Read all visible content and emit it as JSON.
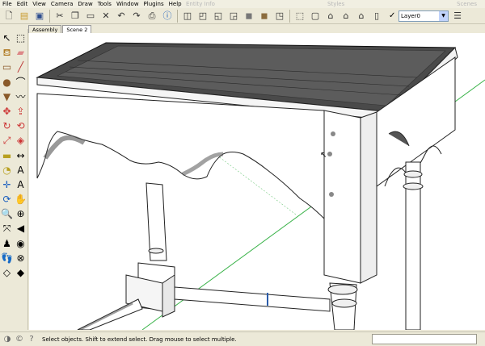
{
  "menu": [
    "File",
    "Edit",
    "View",
    "Camera",
    "Draw",
    "Tools",
    "Window",
    "Plugins",
    "Help"
  ],
  "ghost_titles": [
    "Entity Info",
    "Styles",
    "Scenes"
  ],
  "layer": {
    "label": "Layer0"
  },
  "tabs": [
    {
      "label": "Assembly",
      "active": false
    },
    {
      "label": "Scene 2",
      "active": true
    }
  ],
  "status": {
    "message": "Select objects. Shift to extend select. Drag mouse to select multiple."
  },
  "colors": {
    "chrome": "#ece9d8",
    "viewport": "#ffffff",
    "axis_green": "#3bb34a",
    "wood_dark": "#3c3c3c"
  }
}
